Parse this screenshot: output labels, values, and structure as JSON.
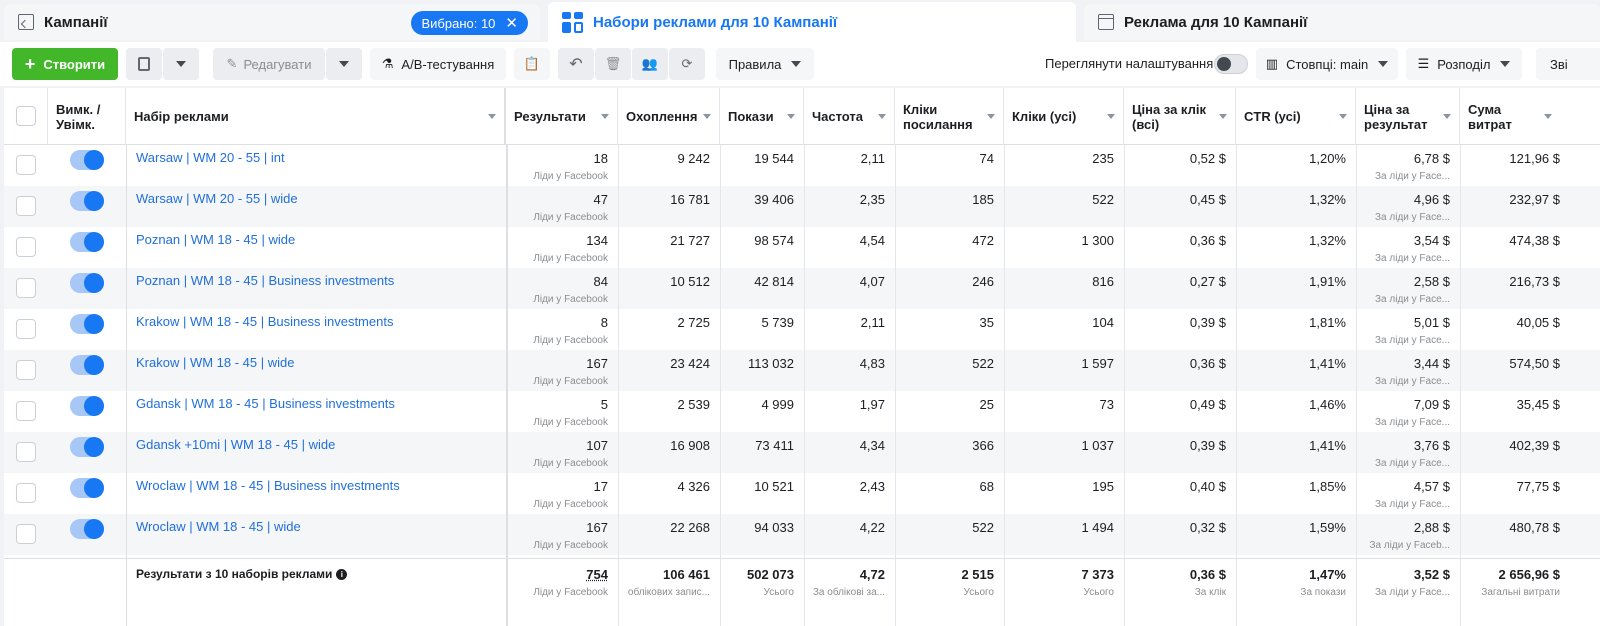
{
  "tabs": {
    "campaigns": "Кампанії",
    "selected_pill": "Вибрано: 10",
    "adsets": "Набори реклами для 10 Кампанії",
    "ads": "Реклама для 10 Кампанії"
  },
  "toolbar": {
    "create": "Створити",
    "edit": "Редагувати",
    "ab_test": "A/B-тестування",
    "rules": "Правила",
    "view_settings": "Переглянути налаштування",
    "columns": "Стовпці: main",
    "breakdown": "Розподіл",
    "more": "Зві"
  },
  "headers": {
    "onoff": "Вимк. / Увімк.",
    "adset": "Набір реклами",
    "results": "Результати",
    "reach": "Охоплення",
    "impressions": "Покази",
    "frequency": "Частота",
    "link_clicks": "Кліки посилання",
    "clicks_all": "Кліки (усі)",
    "cpc_all": "Ціна за клік (всі)",
    "ctr_all": "CTR (усі)",
    "cost_per_result": "Ціна за результат",
    "amount_spent": "Сума витрат"
  },
  "rows": [
    {
      "name": "Warsaw | WM 20 - 55 | int",
      "results": "18",
      "results_sub": "Ліди у Facebook",
      "reach": "9 242",
      "impr": "19 544",
      "freq": "2,11",
      "link": "74",
      "clicks": "235",
      "cpc": "0,52 $",
      "ctr": "1,20%",
      "cpr": "6,78 $",
      "cpr_sub": "За ліди у Face...",
      "spent": "121,96 $"
    },
    {
      "name": "Warsaw | WM 20 - 55 | wide",
      "results": "47",
      "results_sub": "Ліди у Facebook",
      "reach": "16 781",
      "impr": "39 406",
      "freq": "2,35",
      "link": "185",
      "clicks": "522",
      "cpc": "0,45 $",
      "ctr": "1,32%",
      "cpr": "4,96 $",
      "cpr_sub": "За ліди у Face...",
      "spent": "232,97 $"
    },
    {
      "name": "Poznan | WM 18 - 45 | wide",
      "results": "134",
      "results_sub": "Ліди у Facebook",
      "reach": "21 727",
      "impr": "98 574",
      "freq": "4,54",
      "link": "472",
      "clicks": "1 300",
      "cpc": "0,36 $",
      "ctr": "1,32%",
      "cpr": "3,54 $",
      "cpr_sub": "За ліди у Face...",
      "spent": "474,38 $"
    },
    {
      "name": "Poznan | WM 18 - 45 | Business investments",
      "results": "84",
      "results_sub": "Ліди у Facebook",
      "reach": "10 512",
      "impr": "42 814",
      "freq": "4,07",
      "link": "246",
      "clicks": "816",
      "cpc": "0,27 $",
      "ctr": "1,91%",
      "cpr": "2,58 $",
      "cpr_sub": "За ліди у Face...",
      "spent": "216,73 $"
    },
    {
      "name": "Krakow | WM 18 - 45 | Business investments",
      "results": "8",
      "results_sub": "Ліди у Facebook",
      "reach": "2 725",
      "impr": "5 739",
      "freq": "2,11",
      "link": "35",
      "clicks": "104",
      "cpc": "0,39 $",
      "ctr": "1,81%",
      "cpr": "5,01 $",
      "cpr_sub": "За ліди у Face...",
      "spent": "40,05 $"
    },
    {
      "name": "Krakow | WM 18 - 45 | wide",
      "results": "167",
      "results_sub": "Ліди у Facebook",
      "reach": "23 424",
      "impr": "113 032",
      "freq": "4,83",
      "link": "522",
      "clicks": "1 597",
      "cpc": "0,36 $",
      "ctr": "1,41%",
      "cpr": "3,44 $",
      "cpr_sub": "За ліди у Face...",
      "spent": "574,50 $"
    },
    {
      "name": "Gdansk | WM 18 - 45 | Business investments",
      "results": "5",
      "results_sub": "Ліди у Facebook",
      "reach": "2 539",
      "impr": "4 999",
      "freq": "1,97",
      "link": "25",
      "clicks": "73",
      "cpc": "0,49 $",
      "ctr": "1,46%",
      "cpr": "7,09 $",
      "cpr_sub": "За ліди у Face...",
      "spent": "35,45 $"
    },
    {
      "name": "Gdansk +10mi | WM 18 - 45 | wide",
      "results": "107",
      "results_sub": "Ліди у Facebook",
      "reach": "16 908",
      "impr": "73 411",
      "freq": "4,34",
      "link": "366",
      "clicks": "1 037",
      "cpc": "0,39 $",
      "ctr": "1,41%",
      "cpr": "3,76 $",
      "cpr_sub": "За ліди у Face...",
      "spent": "402,39 $"
    },
    {
      "name": "Wroclaw | WM 18 - 45 | Business investments",
      "results": "17",
      "results_sub": "Ліди у Facebook",
      "reach": "4 326",
      "impr": "10 521",
      "freq": "2,43",
      "link": "68",
      "clicks": "195",
      "cpc": "0,40 $",
      "ctr": "1,85%",
      "cpr": "4,57 $",
      "cpr_sub": "За ліди у Face...",
      "spent": "77,75 $"
    },
    {
      "name": "Wroclaw | WM 18 - 45 | wide",
      "results": "167",
      "results_sub": "Ліди у Facebook",
      "reach": "22 268",
      "impr": "94 033",
      "freq": "4,22",
      "link": "522",
      "clicks": "1 494",
      "cpc": "0,32 $",
      "ctr": "1,59%",
      "cpr": "2,88 $",
      "cpr_sub": "За ліди у Faceb...",
      "spent": "480,78 $"
    }
  ],
  "totals": {
    "label": "Результати з 10 наборів реклами",
    "results": "754",
    "results_sub": "Ліди у Facebook",
    "reach": "106 461",
    "reach_sub": "облікових запис...",
    "impr": "502 073",
    "impr_sub": "Усього",
    "freq": "4,72",
    "freq_sub": "За облікові за...",
    "link": "2 515",
    "link_sub": "Усього",
    "clicks": "7 373",
    "clicks_sub": "Усього",
    "cpc": "0,36 $",
    "cpc_sub": "За клік",
    "ctr": "1,47%",
    "ctr_sub": "За покази",
    "cpr": "3,52 $",
    "cpr_sub": "За ліди у Face...",
    "spent": "2 656,96 $",
    "spent_sub": "Загальні витрати"
  },
  "colors": {
    "accent": "#1877f2",
    "create": "#42b72a",
    "link": "#216fdb"
  }
}
